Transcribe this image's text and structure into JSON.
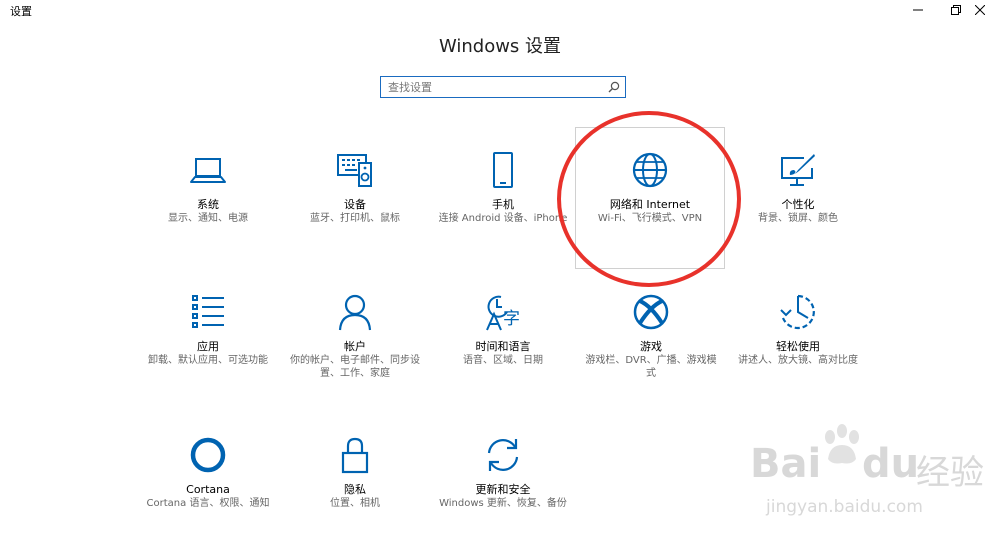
{
  "window": {
    "app_title": "设置"
  },
  "page_title": "Windows 设置",
  "search": {
    "placeholder": "查找设置"
  },
  "colors": {
    "accent": "#0063b1",
    "highlight_circle": "#e8322b"
  },
  "tiles": [
    {
      "name": "系统",
      "desc": "显示、通知、电源",
      "icon": "laptop-icon"
    },
    {
      "name": "设备",
      "desc": "蓝牙、打印机、鼠标",
      "icon": "devices-icon"
    },
    {
      "name": "手机",
      "desc": "连接 Android 设备、iPhone",
      "icon": "phone-icon"
    },
    {
      "name": "网络和 Internet",
      "desc": "Wi-Fi、飞行模式、VPN",
      "icon": "globe-icon"
    },
    {
      "name": "个性化",
      "desc": "背景、锁屏、颜色",
      "icon": "personalization-icon"
    },
    {
      "name": "应用",
      "desc": "卸载、默认应用、可选功能",
      "icon": "apps-list-icon"
    },
    {
      "name": "帐户",
      "desc": "你的帐户、电子邮件、同步设置、工作、家庭",
      "icon": "person-icon"
    },
    {
      "name": "时间和语言",
      "desc": "语音、区域、日期",
      "icon": "time-language-icon"
    },
    {
      "name": "游戏",
      "desc": "游戏栏、DVR、广播、游戏模式",
      "icon": "xbox-icon"
    },
    {
      "name": "轻松使用",
      "desc": "讲述人、放大镜、高对比度",
      "icon": "ease-of-access-icon"
    },
    {
      "name": "Cortana",
      "desc": "Cortana 语言、权限、通知",
      "icon": "cortana-icon"
    },
    {
      "name": "隐私",
      "desc": "位置、相机",
      "icon": "lock-icon"
    },
    {
      "name": "更新和安全",
      "desc": "Windows 更新、恢复、备份",
      "icon": "update-icon"
    }
  ],
  "watermark": {
    "text_1": "Bai",
    "text_2": "du",
    "text_3": "经验",
    "url": "jingyan.baidu.com"
  }
}
